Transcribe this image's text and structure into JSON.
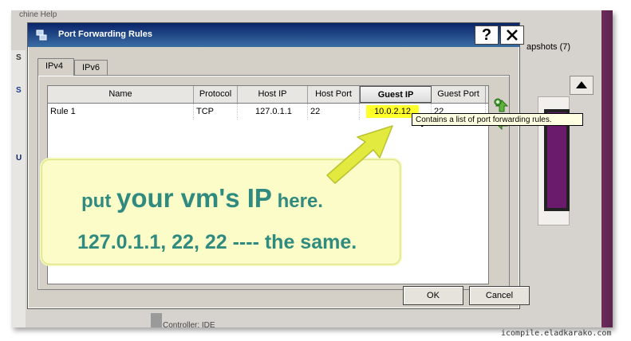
{
  "dialog": {
    "title": "Port Forwarding Rules",
    "help_button": "?",
    "close_button": "X"
  },
  "tabs": [
    {
      "label": "IPv4",
      "active": true
    },
    {
      "label": "IPv6",
      "active": false
    }
  ],
  "table": {
    "columns": [
      "Name",
      "Protocol",
      "Host IP",
      "Host Port",
      "Guest IP",
      "Guest Port"
    ],
    "sorted_column": "Guest IP",
    "rows": [
      {
        "name": "Rule 1",
        "protocol": "TCP",
        "host_ip": "127.0.1.1",
        "host_port": "22",
        "guest_ip": "10.0.2.12",
        "guest_port": "22"
      }
    ]
  },
  "side_buttons": {
    "add": "add-rule-icon",
    "remove": "remove-rule-icon"
  },
  "tooltip": "Contains a list of port forwarding rules.",
  "annotation": {
    "line1_a": "put ",
    "line1_b": "your vm's IP",
    "line1_c": " here.",
    "line2": "127.0.1.1, 22, 22 ---- the same."
  },
  "buttons": {
    "ok": "OK",
    "cancel": "Cancel"
  },
  "background": {
    "menu_fragment": "chine Help",
    "snapshots": "apshots (7)",
    "bottom_fragment": "Controller: IDE"
  },
  "watermark": "icompile.eladkarako.com",
  "colors": {
    "title_bar": "#0a246a",
    "highlight": "#ffff2a",
    "annotation_text": "#2f8b7f",
    "callout_bg": "#fbfcc7"
  }
}
